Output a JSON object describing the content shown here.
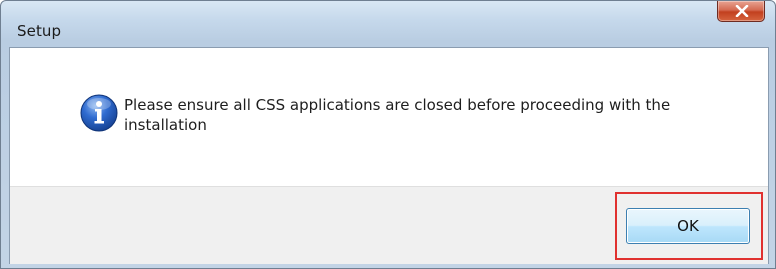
{
  "window": {
    "title": "Setup"
  },
  "titlebar": {
    "close_icon": "close-x-icon"
  },
  "dialog": {
    "icon": "information-icon",
    "message": "Please ensure all CSS applications are closed before proceeding with the installation"
  },
  "buttons": {
    "ok_label": "OK"
  },
  "colors": {
    "highlight": "#e0312f",
    "close_button": "#c2401f",
    "ok_button_border": "#3c7fb1"
  }
}
